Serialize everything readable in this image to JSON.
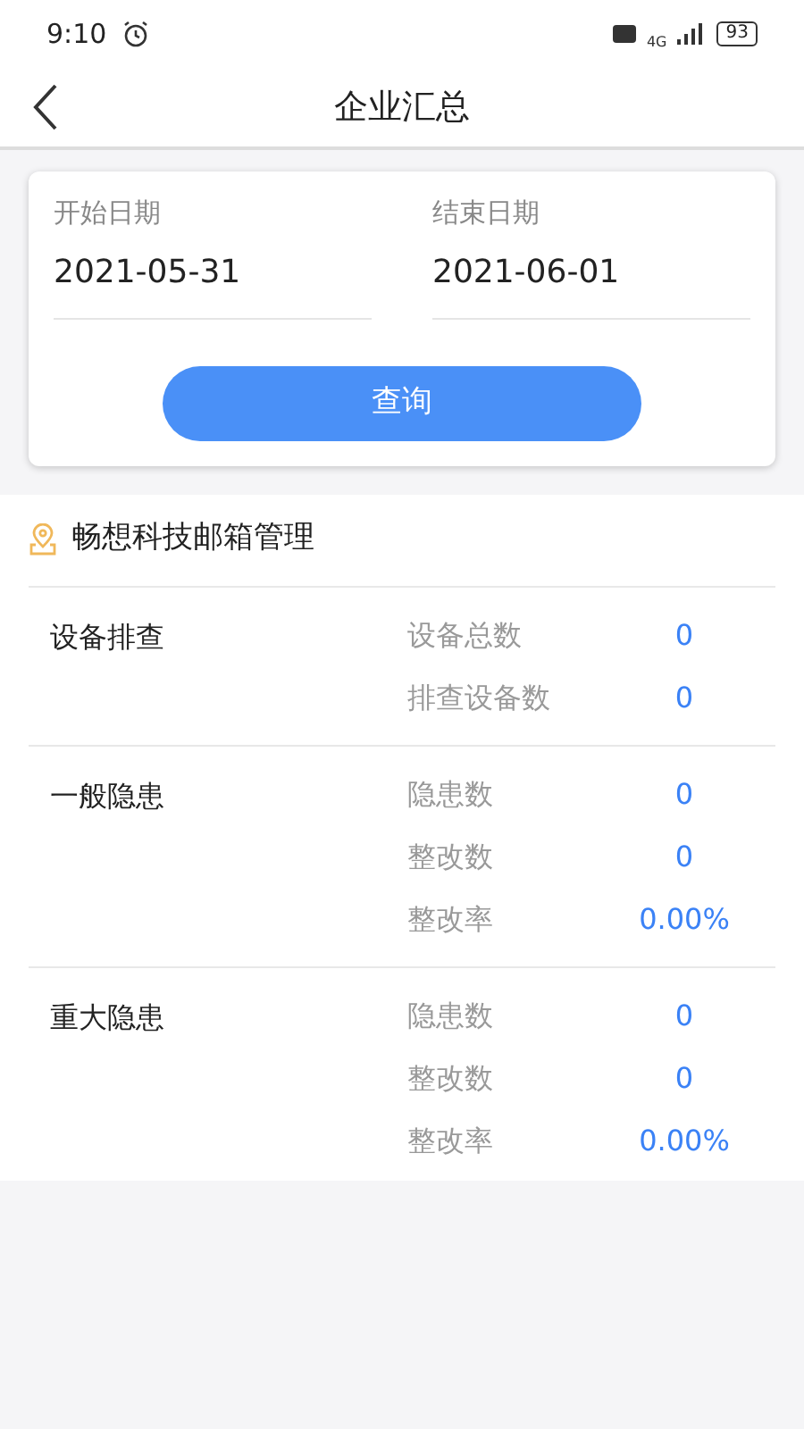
{
  "status_bar": {
    "time": "9:10",
    "network": "4G",
    "battery": "93"
  },
  "header": {
    "title": "企业汇总"
  },
  "query": {
    "start": {
      "label": "开始日期",
      "value": "2021-05-31"
    },
    "end": {
      "label": "结束日期",
      "value": "2021-06-01"
    },
    "button": "查询"
  },
  "company": {
    "name": "畅想科技邮箱管理"
  },
  "groups": [
    {
      "title": "设备排查",
      "metrics": [
        {
          "label": "设备总数",
          "value": "0"
        },
        {
          "label": "排查设备数",
          "value": "0"
        }
      ]
    },
    {
      "title": "一般隐患",
      "metrics": [
        {
          "label": "隐患数",
          "value": "0"
        },
        {
          "label": "整改数",
          "value": "0"
        },
        {
          "label": "整改率",
          "value": "0.00%"
        }
      ]
    },
    {
      "title": "重大隐患",
      "metrics": [
        {
          "label": "隐患数",
          "value": "0"
        },
        {
          "label": "整改数",
          "value": "0"
        },
        {
          "label": "整改率",
          "value": "0.00%"
        }
      ]
    }
  ]
}
